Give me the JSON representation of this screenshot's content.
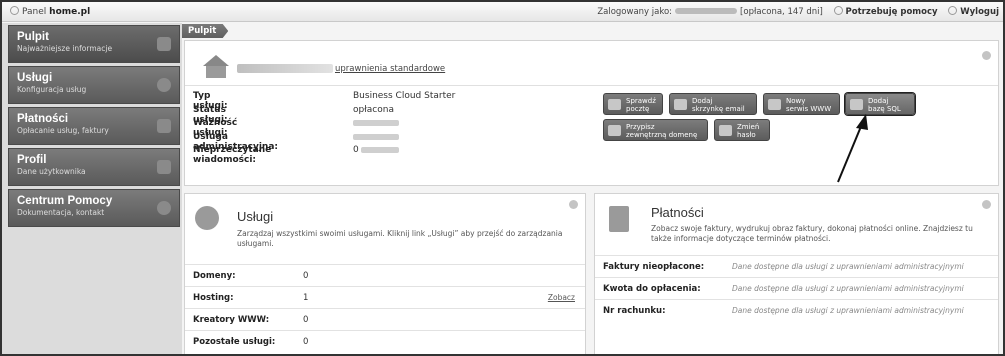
{
  "topbar": {
    "brand_prefix": "Panel",
    "brand_name": "home.pl",
    "logged_as_label": "Zalogowany jako:",
    "account_status": "[opłacona, 147 dni]",
    "help_label": "Potrzebuję pomocy",
    "logout_label": "Wyloguj"
  },
  "sidebar": {
    "items": [
      {
        "title": "Pulpit",
        "subtitle": "Najważniejsze informacje"
      },
      {
        "title": "Usługi",
        "subtitle": "Konfiguracja usług"
      },
      {
        "title": "Płatności",
        "subtitle": "Opłacanie usług, faktury"
      },
      {
        "title": "Profil",
        "subtitle": "Dane użytkownika"
      },
      {
        "title": "Centrum Pomocy",
        "subtitle": "Dokumentacja, kontakt"
      }
    ]
  },
  "breadcrumb": "Pulpit",
  "service": {
    "link_label": "uprawnienia standardowe",
    "rows": [
      {
        "key": "Typ usługi:",
        "value": "Business Cloud Starter"
      },
      {
        "key": "Status usługi:",
        "value": "opłacona"
      },
      {
        "key": "Ważność usługi:",
        "value": ""
      },
      {
        "key": "Usługa administracyjna:",
        "value": ""
      },
      {
        "key": "Nieprzeczytane wiadomości:",
        "value": "0"
      }
    ]
  },
  "actions": [
    {
      "line1": "Sprawdź",
      "line2": "pocztę"
    },
    {
      "line1": "Dodaj",
      "line2": "skrzynkę email"
    },
    {
      "line1": "Nowy",
      "line2": "serwis WWW"
    },
    {
      "line1": "Dodaj",
      "line2": "bazę SQL"
    },
    {
      "line1": "Przypisz",
      "line2": "zewnętrzną domenę"
    },
    {
      "line1": "Zmień",
      "line2": "hasło"
    }
  ],
  "uslugi_box": {
    "title": "Usługi",
    "description": "Zarządzaj wszystkimi swoimi usługami. Kliknij link „Usługi” aby przejść do zarządzania usługami.",
    "rows": [
      {
        "key": "Domeny:",
        "value": "0"
      },
      {
        "key": "Hosting:",
        "value": "1",
        "link": "Zobacz"
      },
      {
        "key": "Kreatory WWW:",
        "value": "0"
      },
      {
        "key": "Pozostałe usługi:",
        "value": "0"
      }
    ]
  },
  "platnosci_box": {
    "title": "Płatności",
    "description": "Zobacz swoje faktury, wydrukuj obraz faktury, dokonaj płatności online. Znajdziesz tu także informacje dotyczące terminów płatności.",
    "rows": [
      {
        "key": "Faktury nieopłacone:",
        "value": "Dane dostępne dla usługi z uprawnieniami administracyjnymi"
      },
      {
        "key": "Kwota do opłacenia:",
        "value": "Dane dostępne dla usługi z uprawnieniami administracyjnymi"
      },
      {
        "key": "Nr rachunku:",
        "value": "Dane dostępne dla usługi z uprawnieniami administracyjnymi"
      }
    ]
  }
}
